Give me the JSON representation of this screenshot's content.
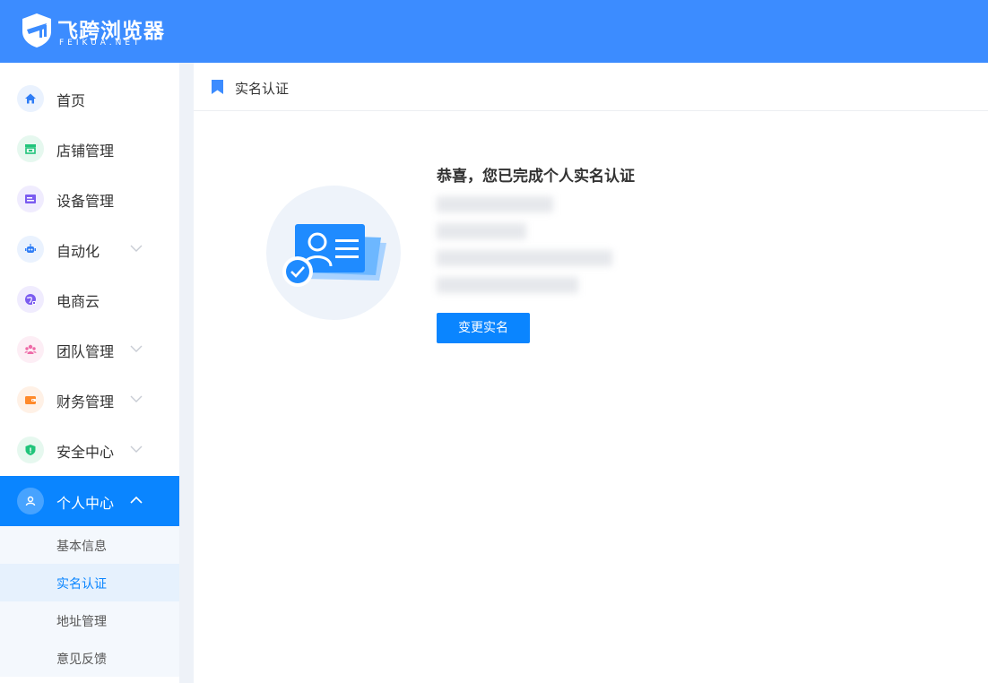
{
  "header": {
    "logo_cn": "飞跨浏览器",
    "logo_en": "FEIKUA.NET",
    "bg_color": "#3c8cff"
  },
  "sidebar": {
    "items": [
      {
        "label": "首页",
        "icon": "home-icon",
        "color": "#2f7df6"
      },
      {
        "label": "店铺管理",
        "icon": "store-icon",
        "color": "#21c47b"
      },
      {
        "label": "设备管理",
        "icon": "device-icon",
        "color": "#7b5cf0"
      },
      {
        "label": "自动化",
        "icon": "robot-icon",
        "color": "#2f7df6",
        "expandable": true
      },
      {
        "label": "电商云",
        "icon": "cloud-globe-icon",
        "color": "#7b5cf0"
      },
      {
        "label": "团队管理",
        "icon": "team-icon",
        "color": "#ee6aa7",
        "expandable": true
      },
      {
        "label": "财务管理",
        "icon": "wallet-icon",
        "color": "#ff8a2b",
        "expandable": true
      },
      {
        "label": "安全中心",
        "icon": "shield-icon",
        "color": "#21c47b",
        "expandable": true
      },
      {
        "label": "个人中心",
        "icon": "user-icon",
        "active": true,
        "expanded": true
      }
    ],
    "sub_items": [
      {
        "label": "基本信息"
      },
      {
        "label": "实名认证",
        "selected": true
      },
      {
        "label": "地址管理"
      },
      {
        "label": "意见反馈"
      }
    ],
    "accent_color": "#0a85ff"
  },
  "page": {
    "title": "实名认证",
    "success_title": "恭喜，您已完成个人实名认证",
    "info_lines": [
      "",
      "",
      "",
      ""
    ],
    "change_button": "变更实名"
  }
}
